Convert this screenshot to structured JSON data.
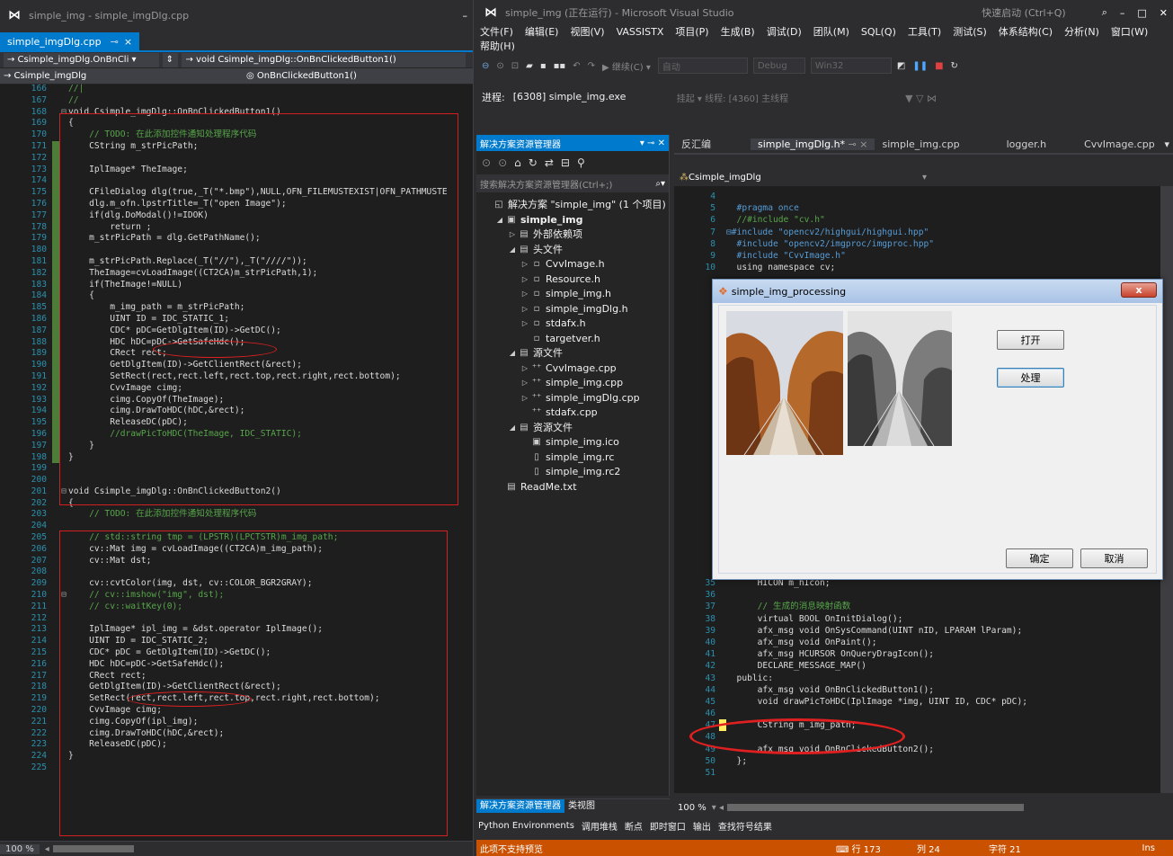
{
  "left": {
    "title": "simple_img - simple_imgDlg.cpp",
    "tab": "simple_imgDlg.cpp",
    "nav1": "→ Csimple_imgDlg.OnBnCli ▾",
    "nav2": "→ void Csimple_imgDlg::OnBnClickedButton1()",
    "nav3": "→ Csimple_imgDlg",
    "nav4": "◎ OnBnClickedButton1()",
    "zoom": "100 %",
    "lines": [
      {
        "n": "166",
        "t": "//|",
        "c": "cmt"
      },
      {
        "n": "167",
        "t": "//",
        "c": "cmt"
      },
      {
        "n": "168",
        "t": "void Csimple_imgDlg::OnBnClickedButton1()",
        "c": "code",
        "f": "⊟"
      },
      {
        "n": "169",
        "t": "{",
        "c": "code"
      },
      {
        "n": "170",
        "t": "    // TODO: 在此添加控件通知处理程序代码",
        "c": "cmt"
      },
      {
        "n": "171",
        "t": "    CString m_strPicPath;",
        "c": "code"
      },
      {
        "n": "172",
        "t": "",
        "c": "code"
      },
      {
        "n": "173",
        "t": "    IplImage* TheImage;",
        "c": "code"
      },
      {
        "n": "174",
        "t": "",
        "c": "code"
      },
      {
        "n": "175",
        "t": "    CFileDialog dlg(true,_T(\"*.bmp\"),NULL,OFN_FILEMUSTEXIST|OFN_PATHMUSTE",
        "c": "code"
      },
      {
        "n": "176",
        "t": "    dlg.m_ofn.lpstrTitle=_T(\"open Image\");",
        "c": "code"
      },
      {
        "n": "177",
        "t": "    if(dlg.DoModal()!=IDOK)",
        "c": "code"
      },
      {
        "n": "178",
        "t": "        return ;",
        "c": "code"
      },
      {
        "n": "179",
        "t": "    m_strPicPath = dlg.GetPathName();",
        "c": "code"
      },
      {
        "n": "180",
        "t": "",
        "c": "code"
      },
      {
        "n": "181",
        "t": "    m_strPicPath.Replace(_T(\"//\"),_T(\"////\"));",
        "c": "code"
      },
      {
        "n": "182",
        "t": "    TheImage=cvLoadImage((CT2CA)m_strPicPath,1);",
        "c": "code"
      },
      {
        "n": "183",
        "t": "    if(TheImage!=NULL)",
        "c": "code"
      },
      {
        "n": "184",
        "t": "    {",
        "c": "code"
      },
      {
        "n": "185",
        "t": "        m_img_path = m_strPicPath;",
        "c": "code"
      },
      {
        "n": "186",
        "t": "        UINT ID = IDC_STATIC_1;",
        "c": "code"
      },
      {
        "n": "187",
        "t": "        CDC* pDC=GetDlgItem(ID)->GetDC();",
        "c": "code"
      },
      {
        "n": "188",
        "t": "        HDC hDC=pDC->GetSafeHdc();",
        "c": "code"
      },
      {
        "n": "189",
        "t": "        CRect rect;",
        "c": "code"
      },
      {
        "n": "190",
        "t": "        GetDlgItem(ID)->GetClientRect(&rect);",
        "c": "code"
      },
      {
        "n": "191",
        "t": "        SetRect(rect,rect.left,rect.top,rect.right,rect.bottom);",
        "c": "code"
      },
      {
        "n": "192",
        "t": "        CvvImage cimg;",
        "c": "code"
      },
      {
        "n": "193",
        "t": "        cimg.CopyOf(TheImage);",
        "c": "code"
      },
      {
        "n": "194",
        "t": "        cimg.DrawToHDC(hDC,&rect);",
        "c": "code"
      },
      {
        "n": "195",
        "t": "        ReleaseDC(pDC);",
        "c": "code"
      },
      {
        "n": "196",
        "t": "        //drawPicToHDC(TheImage, IDC_STATIC);",
        "c": "cmt"
      },
      {
        "n": "197",
        "t": "    }",
        "c": "code"
      },
      {
        "n": "198",
        "t": "}",
        "c": "code"
      },
      {
        "n": "199",
        "t": "",
        "c": "code"
      },
      {
        "n": "200",
        "t": "",
        "c": "code"
      },
      {
        "n": "201",
        "t": "void Csimple_imgDlg::OnBnClickedButton2()",
        "c": "code",
        "f": "⊟"
      },
      {
        "n": "202",
        "t": "{",
        "c": "code"
      },
      {
        "n": "203",
        "t": "    // TODO: 在此添加控件通知处理程序代码",
        "c": "cmt"
      },
      {
        "n": "204",
        "t": "",
        "c": "code"
      },
      {
        "n": "205",
        "t": "    // std::string tmp = (LPSTR)(LPCTSTR)m_img_path;",
        "c": "cmt"
      },
      {
        "n": "206",
        "t": "    cv::Mat img = cvLoadImage((CT2CA)m_img_path);",
        "c": "code"
      },
      {
        "n": "207",
        "t": "    cv::Mat dst;",
        "c": "code"
      },
      {
        "n": "208",
        "t": "",
        "c": "code"
      },
      {
        "n": "209",
        "t": "    cv::cvtColor(img, dst, cv::COLOR_BGR2GRAY);",
        "c": "code"
      },
      {
        "n": "210",
        "t": "    // cv::imshow(\"img\", dst);",
        "c": "cmt",
        "f": "⊟"
      },
      {
        "n": "211",
        "t": "    // cv::waitKey(0);",
        "c": "cmt"
      },
      {
        "n": "212",
        "t": "",
        "c": "code"
      },
      {
        "n": "213",
        "t": "    IplImage* ipl_img = &dst.operator IplImage();",
        "c": "code"
      },
      {
        "n": "214",
        "t": "    UINT ID = IDC_STATIC_2;",
        "c": "code"
      },
      {
        "n": "215",
        "t": "    CDC* pDC = GetDlgItem(ID)->GetDC();",
        "c": "code"
      },
      {
        "n": "216",
        "t": "    HDC hDC=pDC->GetSafeHdc();",
        "c": "code"
      },
      {
        "n": "217",
        "t": "    CRect rect;",
        "c": "code"
      },
      {
        "n": "218",
        "t": "    GetDlgItem(ID)->GetClientRect(&rect);",
        "c": "code"
      },
      {
        "n": "219",
        "t": "    SetRect(rect,rect.left,rect.top,rect.right,rect.bottom);",
        "c": "code"
      },
      {
        "n": "220",
        "t": "    CvvImage cimg;",
        "c": "code"
      },
      {
        "n": "221",
        "t": "    cimg.CopyOf(ipl_img);",
        "c": "code"
      },
      {
        "n": "222",
        "t": "    cimg.DrawToHDC(hDC,&rect);",
        "c": "code"
      },
      {
        "n": "223",
        "t": "    ReleaseDC(pDC);",
        "c": "code"
      },
      {
        "n": "224",
        "t": "}",
        "c": "code"
      },
      {
        "n": "225",
        "t": "",
        "c": "code"
      }
    ]
  },
  "right": {
    "title": "simple_img (正在运行) - Microsoft Visual Studio",
    "quicklaunch": "快速启动 (Ctrl+Q)",
    "menu": [
      "文件(F)",
      "编辑(E)",
      "视图(V)",
      "VASSISTX",
      "项目(P)",
      "生成(B)",
      "调试(D)",
      "团队(M)",
      "SQL(Q)",
      "工具(T)",
      "测试(S)",
      "体系结构(C)",
      "分析(N)",
      "窗口(W)",
      "帮助(H)"
    ],
    "toolbar": {
      "continue": "▶ 继续(C) ▾",
      "auto": "自动",
      "debug": "Debug",
      "platform": "Win32"
    },
    "process_label": "进程:",
    "process_value": "[6308] simple_img.exe",
    "thread_text": "挂起 ▾  线程: [4360] 主线程",
    "solution_explorer": {
      "title": "解决方案资源管理器",
      "search": "搜索解决方案资源管理器(Ctrl+;)",
      "items": [
        {
          "indent": 0,
          "tri": "",
          "ico": "◱",
          "label": "解决方案 \"simple_img\" (1 个项目)"
        },
        {
          "indent": 1,
          "tri": "◢",
          "ico": "▣",
          "label": "simple_img",
          "bold": true
        },
        {
          "indent": 2,
          "tri": "▷",
          "ico": "▤",
          "label": "外部依赖项"
        },
        {
          "indent": 2,
          "tri": "◢",
          "ico": "▤",
          "label": "头文件"
        },
        {
          "indent": 3,
          "tri": "▷",
          "ico": "▫",
          "label": "CvvImage.h"
        },
        {
          "indent": 3,
          "tri": "▷",
          "ico": "▫",
          "label": "Resource.h"
        },
        {
          "indent": 3,
          "tri": "▷",
          "ico": "▫",
          "label": "simple_img.h"
        },
        {
          "indent": 3,
          "tri": "▷",
          "ico": "▫",
          "label": "simple_imgDlg.h"
        },
        {
          "indent": 3,
          "tri": "▷",
          "ico": "▫",
          "label": "stdafx.h"
        },
        {
          "indent": 3,
          "tri": "",
          "ico": "▫",
          "label": "targetver.h"
        },
        {
          "indent": 2,
          "tri": "◢",
          "ico": "▤",
          "label": "源文件"
        },
        {
          "indent": 3,
          "tri": "▷",
          "ico": "⁺⁺",
          "label": "CvvImage.cpp"
        },
        {
          "indent": 3,
          "tri": "▷",
          "ico": "⁺⁺",
          "label": "simple_img.cpp"
        },
        {
          "indent": 3,
          "tri": "▷",
          "ico": "⁺⁺",
          "label": "simple_imgDlg.cpp"
        },
        {
          "indent": 3,
          "tri": "",
          "ico": "⁺⁺",
          "label": "stdafx.cpp"
        },
        {
          "indent": 2,
          "tri": "◢",
          "ico": "▤",
          "label": "资源文件"
        },
        {
          "indent": 3,
          "tri": "",
          "ico": "▣",
          "label": "simple_img.ico"
        },
        {
          "indent": 3,
          "tri": "",
          "ico": "▯",
          "label": "simple_img.rc"
        },
        {
          "indent": 3,
          "tri": "",
          "ico": "▯",
          "label": "simple_img.rc2"
        },
        {
          "indent": 1,
          "tri": "",
          "ico": "▤",
          "label": "ReadMe.txt"
        }
      ],
      "bottom_tabs": [
        "解决方案资源管理器",
        "类视图"
      ]
    },
    "editor_tabs": [
      "反汇编",
      "simple_imgDlg.h*",
      "simple_img.cpp",
      "logger.h",
      "CvvImage.cpp"
    ],
    "class_nav": "Csimple_imgDlg",
    "code_lines": [
      {
        "n": "4",
        "t": ""
      },
      {
        "n": "5",
        "t": "  #pragma once"
      },
      {
        "n": "6",
        "t": "  //#include \"cv.h\""
      },
      {
        "n": "7",
        "t": "⊟#include \"opencv2/highgui/highgui.hpp\""
      },
      {
        "n": "8",
        "t": "  #include \"opencv2/imgproc/imgproc.hpp\""
      },
      {
        "n": "9",
        "t": "  #include \"CvvImage.h\""
      },
      {
        "n": "10",
        "t": "  using namespace cv;"
      }
    ],
    "code_lines2": [
      {
        "n": "35",
        "t": "      HICON m_hIcon;"
      },
      {
        "n": "36",
        "t": ""
      },
      {
        "n": "37",
        "t": "      // 生成的消息映射函数"
      },
      {
        "n": "38",
        "t": "      virtual BOOL OnInitDialog();"
      },
      {
        "n": "39",
        "t": "      afx_msg void OnSysCommand(UINT nID, LPARAM lParam);"
      },
      {
        "n": "40",
        "t": "      afx_msg void OnPaint();"
      },
      {
        "n": "41",
        "t": "      afx_msg HCURSOR OnQueryDragIcon();"
      },
      {
        "n": "42",
        "t": "      DECLARE_MESSAGE_MAP()"
      },
      {
        "n": "43",
        "t": "  public:"
      },
      {
        "n": "44",
        "t": "      afx_msg void OnBnClickedButton1();"
      },
      {
        "n": "45",
        "t": "      void drawPicToHDC(IplImage *img, UINT ID, CDC* pDC);"
      },
      {
        "n": "46",
        "t": ""
      },
      {
        "n": "47",
        "t": "      CString m_img_path;"
      },
      {
        "n": "48",
        "t": ""
      },
      {
        "n": "49",
        "t": "      afx_msg void OnBnClickedButton2();"
      },
      {
        "n": "50",
        "t": "  };"
      },
      {
        "n": "51",
        "t": ""
      }
    ],
    "zoom": "100 %",
    "bottom_tabs": [
      "Python Environments",
      "调用堆栈",
      "断点",
      "即时窗口",
      "输出",
      "查找符号结果"
    ],
    "status": {
      "msg": "此项不支持预览",
      "line": "行 173",
      "col": "列 24",
      "ch": "字符 21",
      "mode": "Ins"
    }
  },
  "dialog": {
    "title": "simple_img_processing",
    "close": "x",
    "open_label": "打开",
    "process_label": "处理",
    "ok_label": "确定",
    "cancel_label": "取消"
  }
}
